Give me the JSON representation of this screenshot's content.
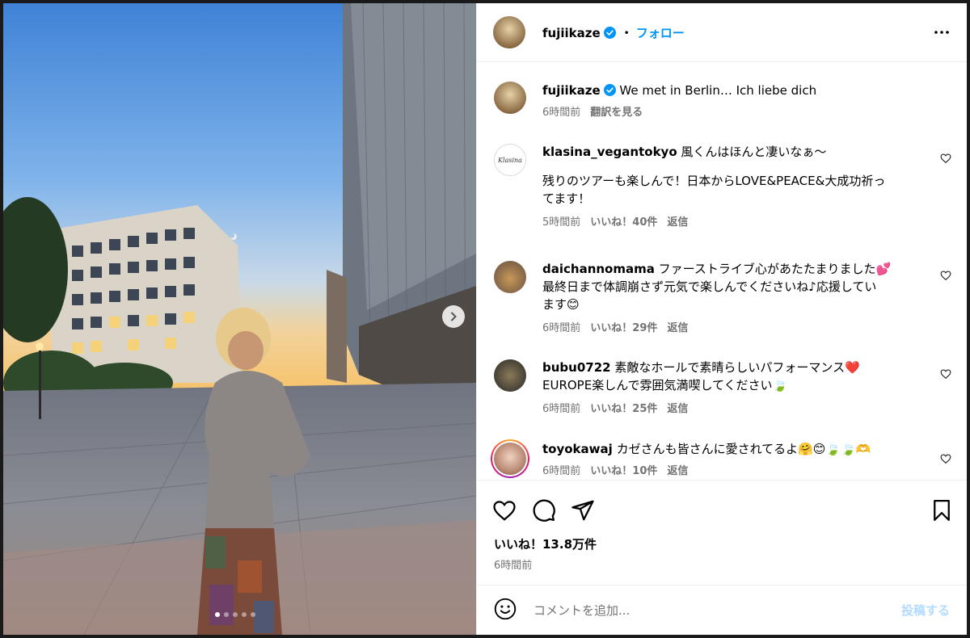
{
  "header": {
    "username": "fujiikaze",
    "separator": "•",
    "follow_label": "フォロー"
  },
  "caption": {
    "username": "fujiikaze",
    "text": "We met in Berlin… Ich liebe dich",
    "time": "6時間前",
    "translate_label": "翻訳を見る"
  },
  "comments": [
    {
      "username": "klasina_vegantokyo",
      "line1": "風くんはほんと凄いなぁ〜",
      "line2": "",
      "line3": "残りのツアーも楽しんで！日本からLOVE&PEACE&大成功祈っ",
      "line4": "てます！",
      "time": "5時間前",
      "likes": "いいね！40件",
      "reply": "返信",
      "avatar_text": "Klasina"
    },
    {
      "username": "daichannomama",
      "line1": "ファーストライブ心があたたまりました💕",
      "line2": "最終日まで体調崩さず元気で楽しんでくださいね♪応援してい",
      "line3": "ます😊",
      "time": "6時間前",
      "likes": "いいね！29件",
      "reply": "返信"
    },
    {
      "username": "bubu0722",
      "line1": "素敵なホールで素晴らしいパフォーマンス❤️",
      "line2": "EUROPE楽しんで雰囲気満喫してください🍃",
      "time": "6時間前",
      "likes": "いいね！25件",
      "reply": "返信"
    },
    {
      "username": "toyokawaj",
      "line1": "カゼさんも皆さんに愛されてるよ🤗😊🍃🍃🫶",
      "time": "6時間前",
      "likes": "いいね！10件",
      "reply": "返信"
    }
  ],
  "likes_total": "いいね！13.8万件",
  "post_time": "6時間前",
  "add_comment": {
    "placeholder": "コメントを追加...",
    "post_label": "投稿する"
  },
  "carousel": {
    "current": 1,
    "total": 5
  },
  "colors": {
    "accent": "#0095f6",
    "verified": "#0095f6",
    "muted": "#737373",
    "post_disabled": "#b3dbff"
  }
}
